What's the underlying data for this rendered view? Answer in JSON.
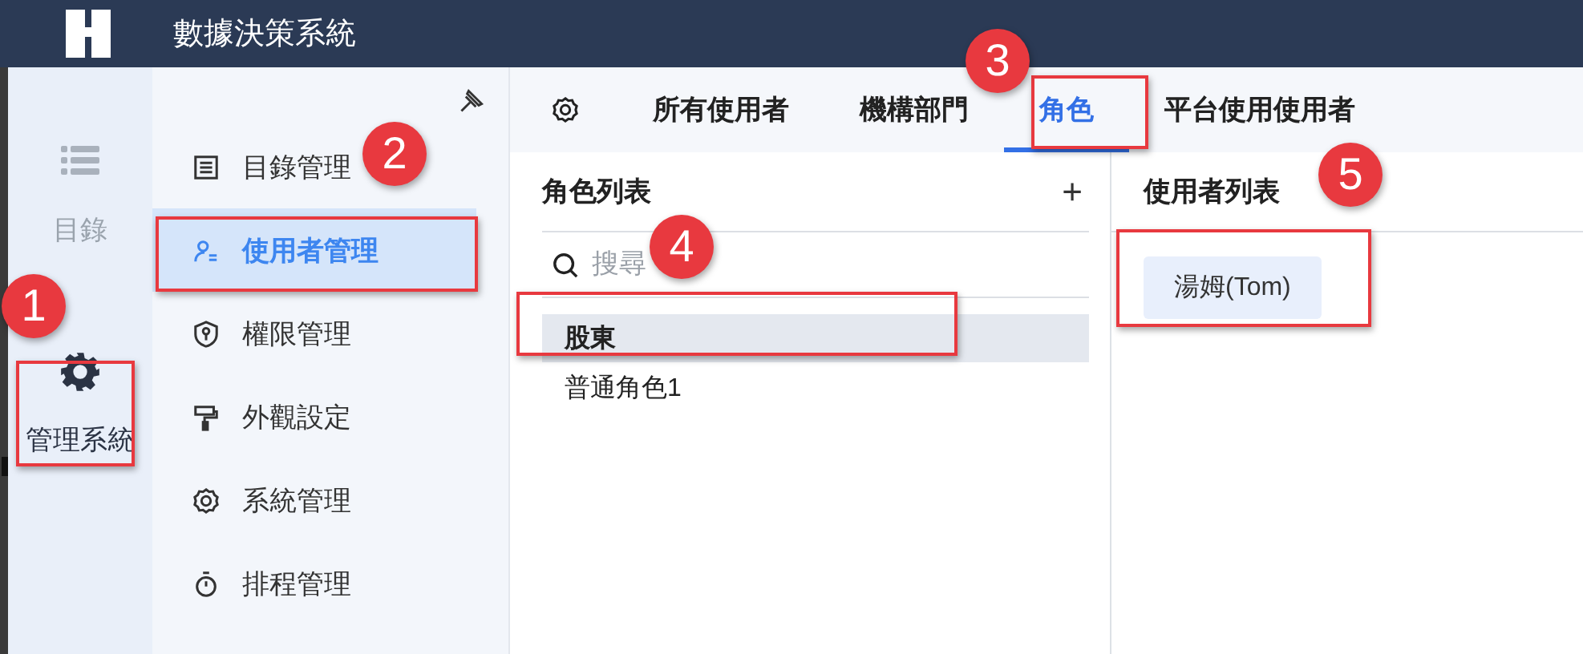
{
  "header": {
    "title": "數據決策系統"
  },
  "rail": [
    {
      "label": "目錄",
      "selected": false
    },
    {
      "label": "管理系統",
      "selected": true
    }
  ],
  "menu": [
    {
      "label": "目錄管理",
      "selected": false
    },
    {
      "label": "使用者管理",
      "selected": true
    },
    {
      "label": "權限管理",
      "selected": false
    },
    {
      "label": "外觀設定",
      "selected": false
    },
    {
      "label": "系統管理",
      "selected": false
    },
    {
      "label": "排程管理",
      "selected": false
    }
  ],
  "tabs": [
    {
      "label": "所有使用者",
      "selected": false
    },
    {
      "label": "機構部門",
      "selected": false
    },
    {
      "label": "角色",
      "selected": true
    },
    {
      "label": "平台使用使用者",
      "selected": false
    }
  ],
  "role_panel": {
    "title": "角色列表",
    "add": "+",
    "search": {
      "placeholder": "搜尋"
    },
    "roles": [
      {
        "name": "股東",
        "selected": true
      },
      {
        "name": "普通角色1",
        "selected": false
      }
    ]
  },
  "user_panel": {
    "title": "使用者列表",
    "users": [
      "湯姆(Tom)"
    ]
  },
  "callouts": [
    {
      "number": "1"
    },
    {
      "number": "2"
    },
    {
      "number": "3"
    },
    {
      "number": "4"
    },
    {
      "number": "5"
    }
  ]
}
